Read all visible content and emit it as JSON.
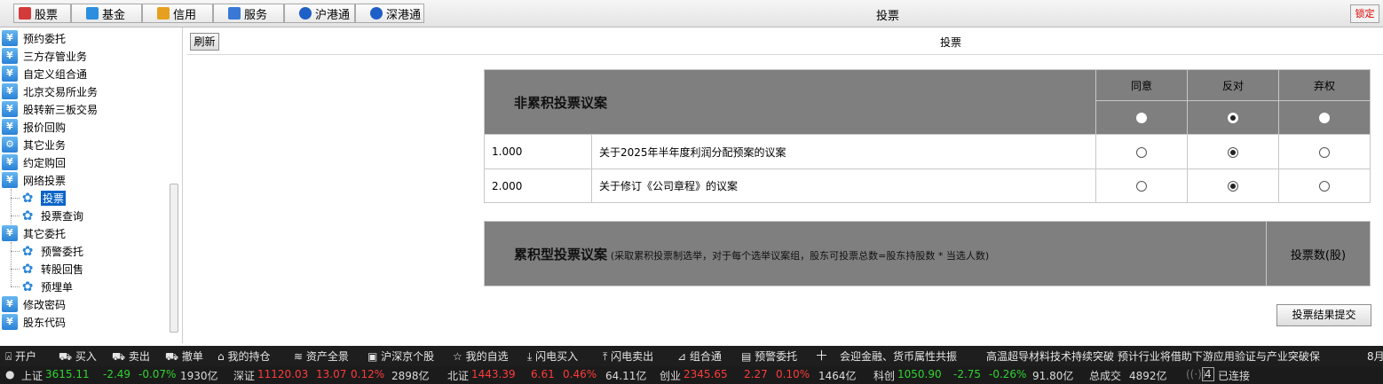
{
  "tabs": [
    {
      "label": "股票",
      "color": "#d43a3a"
    },
    {
      "label": "基金",
      "color": "#2d8ee0"
    },
    {
      "label": "信用",
      "color": "#e6a020"
    },
    {
      "label": "服务",
      "color": "#3a78d6"
    },
    {
      "label": "沪港通",
      "color": "#1f5fc8"
    },
    {
      "label": "深港通",
      "color": "#1f5fc8"
    }
  ],
  "window_title": "投票",
  "lock_label": "锁定",
  "sidebar": {
    "items": [
      "预约委托",
      "三方存管业务",
      "自定义组合通",
      "北京交易所业务",
      "股转新三板交易",
      "报价回购",
      "其它业务",
      "约定购回",
      "网络投票",
      "投票",
      "投票查询",
      "其它委托",
      "预警委托",
      "转股回售",
      "预埋单",
      "修改密码",
      "股东代码"
    ]
  },
  "toolbar": {
    "refresh_label": "刷新",
    "title": "投票"
  },
  "noncum": {
    "title": "非累积投票议案",
    "agree": "同意",
    "oppose": "反对",
    "abstain": "弃权",
    "rows": [
      {
        "no": "1.000",
        "desc": "关于2025年半年度利润分配预案的议案"
      },
      {
        "no": "2.000",
        "desc": "关于修订《公司章程》的议案"
      }
    ],
    "selected": "反对"
  },
  "cum": {
    "title": "累积型投票议案",
    "note": "(采取累积投票制选举，对于每个选举议案组，股东可投票总数=股东持股数 * 当选人数)",
    "col": "投票数(股)"
  },
  "submit_label": "投票结果提交",
  "quickbar": [
    "开户",
    "买入",
    "卖出",
    "撤单",
    "我的持仓",
    "资产全景",
    "沪深京个股",
    "我的自选",
    "闪电买入",
    "闪电卖出",
    "组合通",
    "预警委托"
  ],
  "news": [
    "会迎金融、货币属性共振",
    "高温超导材料技术持续突破 预计行业将借助下游应用验证与产业突破保"
  ],
  "news_date": "8月",
  "ticker": {
    "sh": {
      "name": "上证",
      "price": "3615.11",
      "chg": "-2.49",
      "pct": "-0.07%",
      "amt": "1930亿"
    },
    "sz": {
      "name": "深证",
      "price": "11120.03",
      "chg": "13.07",
      "pct": "0.12%",
      "amt": "2898亿"
    },
    "bj": {
      "name": "北证",
      "price": "1443.39",
      "chg": "6.61",
      "pct": "0.46%",
      "amt": "64.11亿"
    },
    "cy": {
      "name": "创业",
      "price": "2345.65",
      "chg": "2.27",
      "pct": "0.10%",
      "amt": "1464亿"
    },
    "kc": {
      "name": "科创",
      "price": "1050.90",
      "chg": "-2.75",
      "pct": "-0.26%",
      "amt": "91.80亿"
    },
    "total_label": "总成交",
    "total": "4892亿",
    "conn_count": "4",
    "conn": "已连接"
  }
}
